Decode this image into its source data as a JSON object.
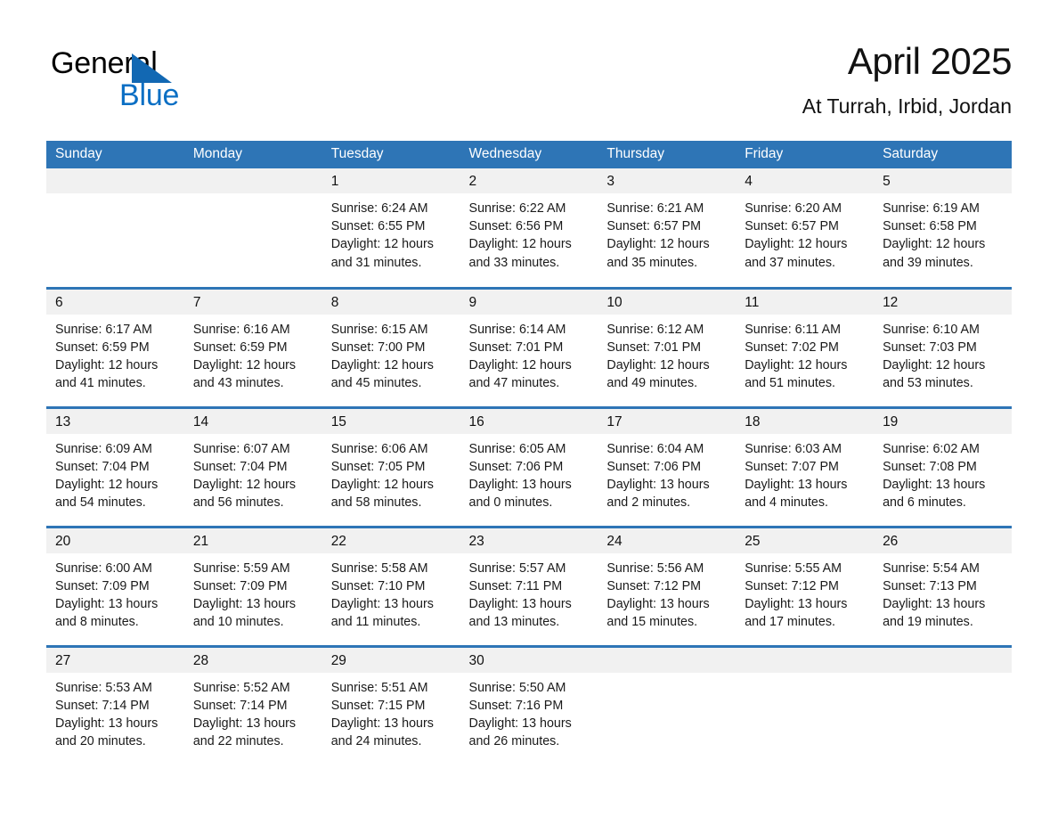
{
  "brand": {
    "line1": "General",
    "line2": "Blue",
    "mark": "triangle-logo",
    "color_dark": "#000000",
    "color_blue": "#0b6fc4"
  },
  "header": {
    "title": "April 2025",
    "subtitle": "At Turrah, Irbid, Jordan"
  },
  "theme": {
    "header_blue": "#2e75b6",
    "daynum_band": "#f1f1f1",
    "page_background": "#ffffff",
    "text": "#1a1a1a"
  },
  "weekday_headers": [
    "Sunday",
    "Monday",
    "Tuesday",
    "Wednesday",
    "Thursday",
    "Friday",
    "Saturday"
  ],
  "weeks": [
    [
      {
        "day": "",
        "empty": true
      },
      {
        "day": "",
        "empty": true
      },
      {
        "day": "1",
        "sunrise": "Sunrise: 6:24 AM",
        "sunset": "Sunset: 6:55 PM",
        "daylight_line1": "Daylight: 12 hours",
        "daylight_line2": "and 31 minutes."
      },
      {
        "day": "2",
        "sunrise": "Sunrise: 6:22 AM",
        "sunset": "Sunset: 6:56 PM",
        "daylight_line1": "Daylight: 12 hours",
        "daylight_line2": "and 33 minutes."
      },
      {
        "day": "3",
        "sunrise": "Sunrise: 6:21 AM",
        "sunset": "Sunset: 6:57 PM",
        "daylight_line1": "Daylight: 12 hours",
        "daylight_line2": "and 35 minutes."
      },
      {
        "day": "4",
        "sunrise": "Sunrise: 6:20 AM",
        "sunset": "Sunset: 6:57 PM",
        "daylight_line1": "Daylight: 12 hours",
        "daylight_line2": "and 37 minutes."
      },
      {
        "day": "5",
        "sunrise": "Sunrise: 6:19 AM",
        "sunset": "Sunset: 6:58 PM",
        "daylight_line1": "Daylight: 12 hours",
        "daylight_line2": "and 39 minutes."
      }
    ],
    [
      {
        "day": "6",
        "sunrise": "Sunrise: 6:17 AM",
        "sunset": "Sunset: 6:59 PM",
        "daylight_line1": "Daylight: 12 hours",
        "daylight_line2": "and 41 minutes."
      },
      {
        "day": "7",
        "sunrise": "Sunrise: 6:16 AM",
        "sunset": "Sunset: 6:59 PM",
        "daylight_line1": "Daylight: 12 hours",
        "daylight_line2": "and 43 minutes."
      },
      {
        "day": "8",
        "sunrise": "Sunrise: 6:15 AM",
        "sunset": "Sunset: 7:00 PM",
        "daylight_line1": "Daylight: 12 hours",
        "daylight_line2": "and 45 minutes."
      },
      {
        "day": "9",
        "sunrise": "Sunrise: 6:14 AM",
        "sunset": "Sunset: 7:01 PM",
        "daylight_line1": "Daylight: 12 hours",
        "daylight_line2": "and 47 minutes."
      },
      {
        "day": "10",
        "sunrise": "Sunrise: 6:12 AM",
        "sunset": "Sunset: 7:01 PM",
        "daylight_line1": "Daylight: 12 hours",
        "daylight_line2": "and 49 minutes."
      },
      {
        "day": "11",
        "sunrise": "Sunrise: 6:11 AM",
        "sunset": "Sunset: 7:02 PM",
        "daylight_line1": "Daylight: 12 hours",
        "daylight_line2": "and 51 minutes."
      },
      {
        "day": "12",
        "sunrise": "Sunrise: 6:10 AM",
        "sunset": "Sunset: 7:03 PM",
        "daylight_line1": "Daylight: 12 hours",
        "daylight_line2": "and 53 minutes."
      }
    ],
    [
      {
        "day": "13",
        "sunrise": "Sunrise: 6:09 AM",
        "sunset": "Sunset: 7:04 PM",
        "daylight_line1": "Daylight: 12 hours",
        "daylight_line2": "and 54 minutes."
      },
      {
        "day": "14",
        "sunrise": "Sunrise: 6:07 AM",
        "sunset": "Sunset: 7:04 PM",
        "daylight_line1": "Daylight: 12 hours",
        "daylight_line2": "and 56 minutes."
      },
      {
        "day": "15",
        "sunrise": "Sunrise: 6:06 AM",
        "sunset": "Sunset: 7:05 PM",
        "daylight_line1": "Daylight: 12 hours",
        "daylight_line2": "and 58 minutes."
      },
      {
        "day": "16",
        "sunrise": "Sunrise: 6:05 AM",
        "sunset": "Sunset: 7:06 PM",
        "daylight_line1": "Daylight: 13 hours",
        "daylight_line2": "and 0 minutes."
      },
      {
        "day": "17",
        "sunrise": "Sunrise: 6:04 AM",
        "sunset": "Sunset: 7:06 PM",
        "daylight_line1": "Daylight: 13 hours",
        "daylight_line2": "and 2 minutes."
      },
      {
        "day": "18",
        "sunrise": "Sunrise: 6:03 AM",
        "sunset": "Sunset: 7:07 PM",
        "daylight_line1": "Daylight: 13 hours",
        "daylight_line2": "and 4 minutes."
      },
      {
        "day": "19",
        "sunrise": "Sunrise: 6:02 AM",
        "sunset": "Sunset: 7:08 PM",
        "daylight_line1": "Daylight: 13 hours",
        "daylight_line2": "and 6 minutes."
      }
    ],
    [
      {
        "day": "20",
        "sunrise": "Sunrise: 6:00 AM",
        "sunset": "Sunset: 7:09 PM",
        "daylight_line1": "Daylight: 13 hours",
        "daylight_line2": "and 8 minutes."
      },
      {
        "day": "21",
        "sunrise": "Sunrise: 5:59 AM",
        "sunset": "Sunset: 7:09 PM",
        "daylight_line1": "Daylight: 13 hours",
        "daylight_line2": "and 10 minutes."
      },
      {
        "day": "22",
        "sunrise": "Sunrise: 5:58 AM",
        "sunset": "Sunset: 7:10 PM",
        "daylight_line1": "Daylight: 13 hours",
        "daylight_line2": "and 11 minutes."
      },
      {
        "day": "23",
        "sunrise": "Sunrise: 5:57 AM",
        "sunset": "Sunset: 7:11 PM",
        "daylight_line1": "Daylight: 13 hours",
        "daylight_line2": "and 13 minutes."
      },
      {
        "day": "24",
        "sunrise": "Sunrise: 5:56 AM",
        "sunset": "Sunset: 7:12 PM",
        "daylight_line1": "Daylight: 13 hours",
        "daylight_line2": "and 15 minutes."
      },
      {
        "day": "25",
        "sunrise": "Sunrise: 5:55 AM",
        "sunset": "Sunset: 7:12 PM",
        "daylight_line1": "Daylight: 13 hours",
        "daylight_line2": "and 17 minutes."
      },
      {
        "day": "26",
        "sunrise": "Sunrise: 5:54 AM",
        "sunset": "Sunset: 7:13 PM",
        "daylight_line1": "Daylight: 13 hours",
        "daylight_line2": "and 19 minutes."
      }
    ],
    [
      {
        "day": "27",
        "sunrise": "Sunrise: 5:53 AM",
        "sunset": "Sunset: 7:14 PM",
        "daylight_line1": "Daylight: 13 hours",
        "daylight_line2": "and 20 minutes."
      },
      {
        "day": "28",
        "sunrise": "Sunrise: 5:52 AM",
        "sunset": "Sunset: 7:14 PM",
        "daylight_line1": "Daylight: 13 hours",
        "daylight_line2": "and 22 minutes."
      },
      {
        "day": "29",
        "sunrise": "Sunrise: 5:51 AM",
        "sunset": "Sunset: 7:15 PM",
        "daylight_line1": "Daylight: 13 hours",
        "daylight_line2": "and 24 minutes."
      },
      {
        "day": "30",
        "sunrise": "Sunrise: 5:50 AM",
        "sunset": "Sunset: 7:16 PM",
        "daylight_line1": "Daylight: 13 hours",
        "daylight_line2": "and 26 minutes."
      },
      {
        "day": "",
        "empty": true
      },
      {
        "day": "",
        "empty": true
      },
      {
        "day": "",
        "empty": true
      }
    ]
  ]
}
